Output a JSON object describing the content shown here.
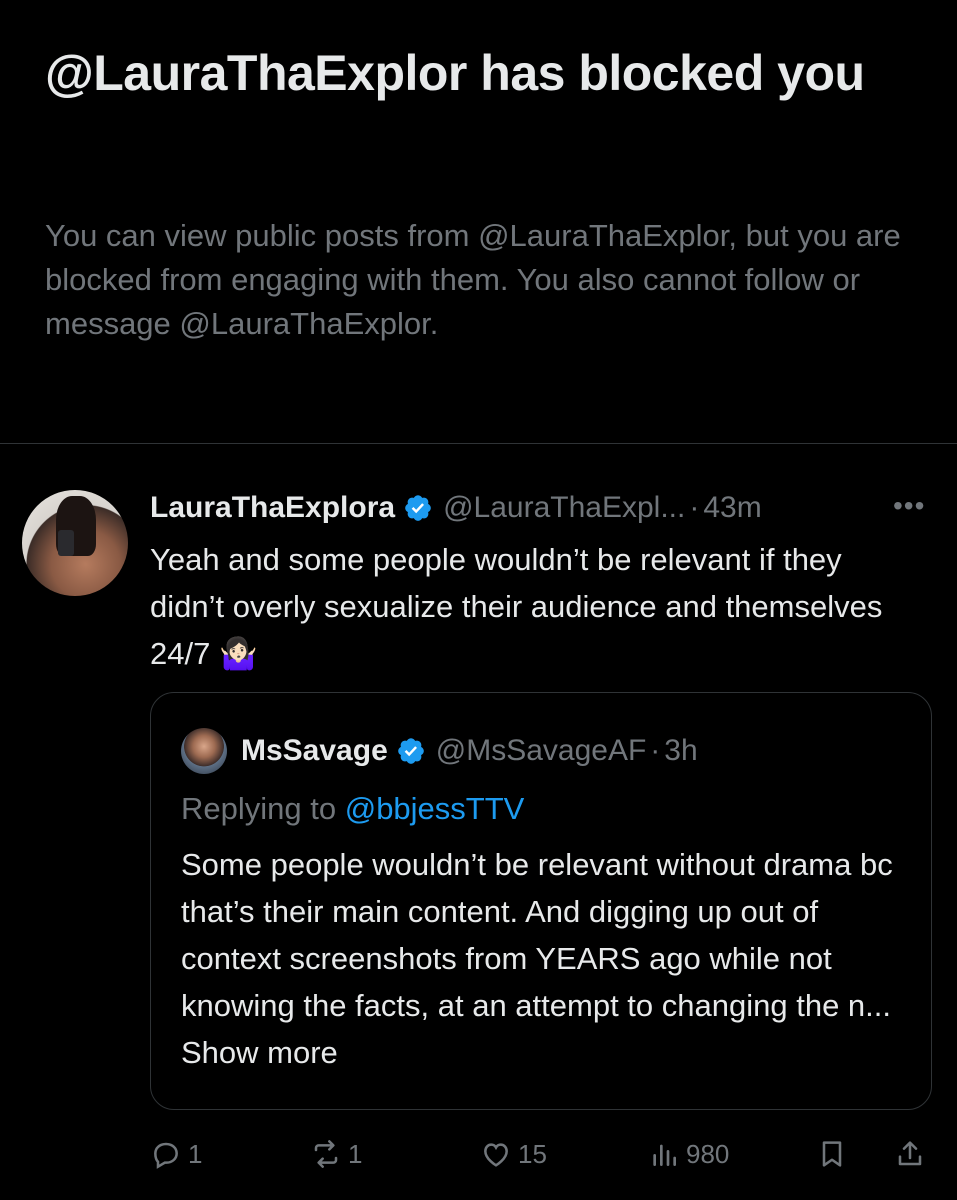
{
  "blocked": {
    "title": "@LauraThaExplor has blocked you",
    "description": "You can view public posts from @LauraThaExplor, but you are blocked from engaging with them. You also cannot follow or message @LauraThaExplor."
  },
  "tweet": {
    "author_name": "LauraThaExplora",
    "handle": "@LauraThaExpl...",
    "separator": "·",
    "time": "43m",
    "more": "•••",
    "text": "Yeah and some people wouldn’t be relevant if they didn’t overly sexualize their audience and themselves 24/7 🤷🏻‍♀️",
    "verified_color": "#1d9bf0"
  },
  "quote": {
    "author_name": "MsSavage",
    "handle": "@MsSavageAF",
    "separator": "·",
    "time": "3h",
    "replying_prefix": "Replying to ",
    "replying_handle": "@bbjessTTV",
    "text": "Some people wouldn’t be relevant without drama bc that’s their main content. And digging up out of context screenshots from YEARS ago while not knowing the facts, at an attempt to changing the n... ",
    "show_more": "Show more"
  },
  "actions": {
    "reply_count": "1",
    "repost_count": "1",
    "like_count": "15",
    "view_count": "980"
  },
  "colors": {
    "background": "#000000",
    "text": "#e7e9ea",
    "muted": "#71767b",
    "accent": "#1d9bf0",
    "border": "#2f3336"
  }
}
